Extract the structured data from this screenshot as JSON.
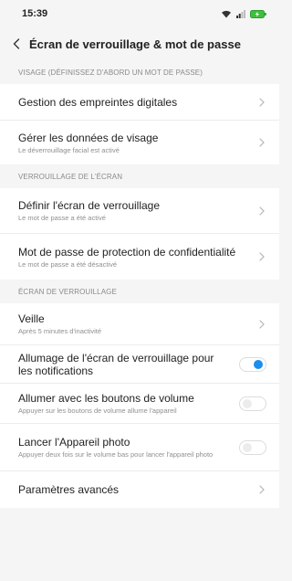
{
  "status": {
    "time": "15:39"
  },
  "header": {
    "title": "Écran de verrouillage & mot de passe"
  },
  "sections": [
    {
      "header": "VISAGE (DÉFINISSEZ D'ABORD UN MOT DE PASSE)",
      "rows": [
        {
          "title": "Gestion des empreintes digitales",
          "sub": ""
        },
        {
          "title": "Gérer les données de visage",
          "sub": "Le déverrouillage facial est activé"
        }
      ]
    },
    {
      "header": "VERROUILLAGE DE L'ÉCRAN",
      "rows": [
        {
          "title": "Définir l'écran de verrouillage",
          "sub": "Le mot de passe a été activé"
        },
        {
          "title": "Mot de passe de protection de confidentialité",
          "sub": "Le mot de passe a été désactivé"
        }
      ]
    },
    {
      "header": "ÉCRAN DE VERROUILLAGE",
      "rows": [
        {
          "title": "Veille",
          "sub": "Après 5 minutes d'inactivité"
        },
        {
          "title": "Allumage de l'écran de verrouillage pour les notifications",
          "sub": "",
          "toggle": true
        },
        {
          "title": "Allumer avec les boutons de volume",
          "sub": "Appuyer sur les boutons de volume allume l'appareil",
          "toggle": false
        },
        {
          "title": "Lancer l'Appareil photo",
          "sub": "Appuyer deux fois sur le volume bas pour lancer l'appareil photo",
          "toggle": false
        },
        {
          "title": "Paramètres avancés",
          "sub": ""
        }
      ]
    }
  ],
  "colors": {
    "accent": "#1a8fee",
    "background": "#f5f5f5",
    "battery": "#3fbf3f"
  }
}
